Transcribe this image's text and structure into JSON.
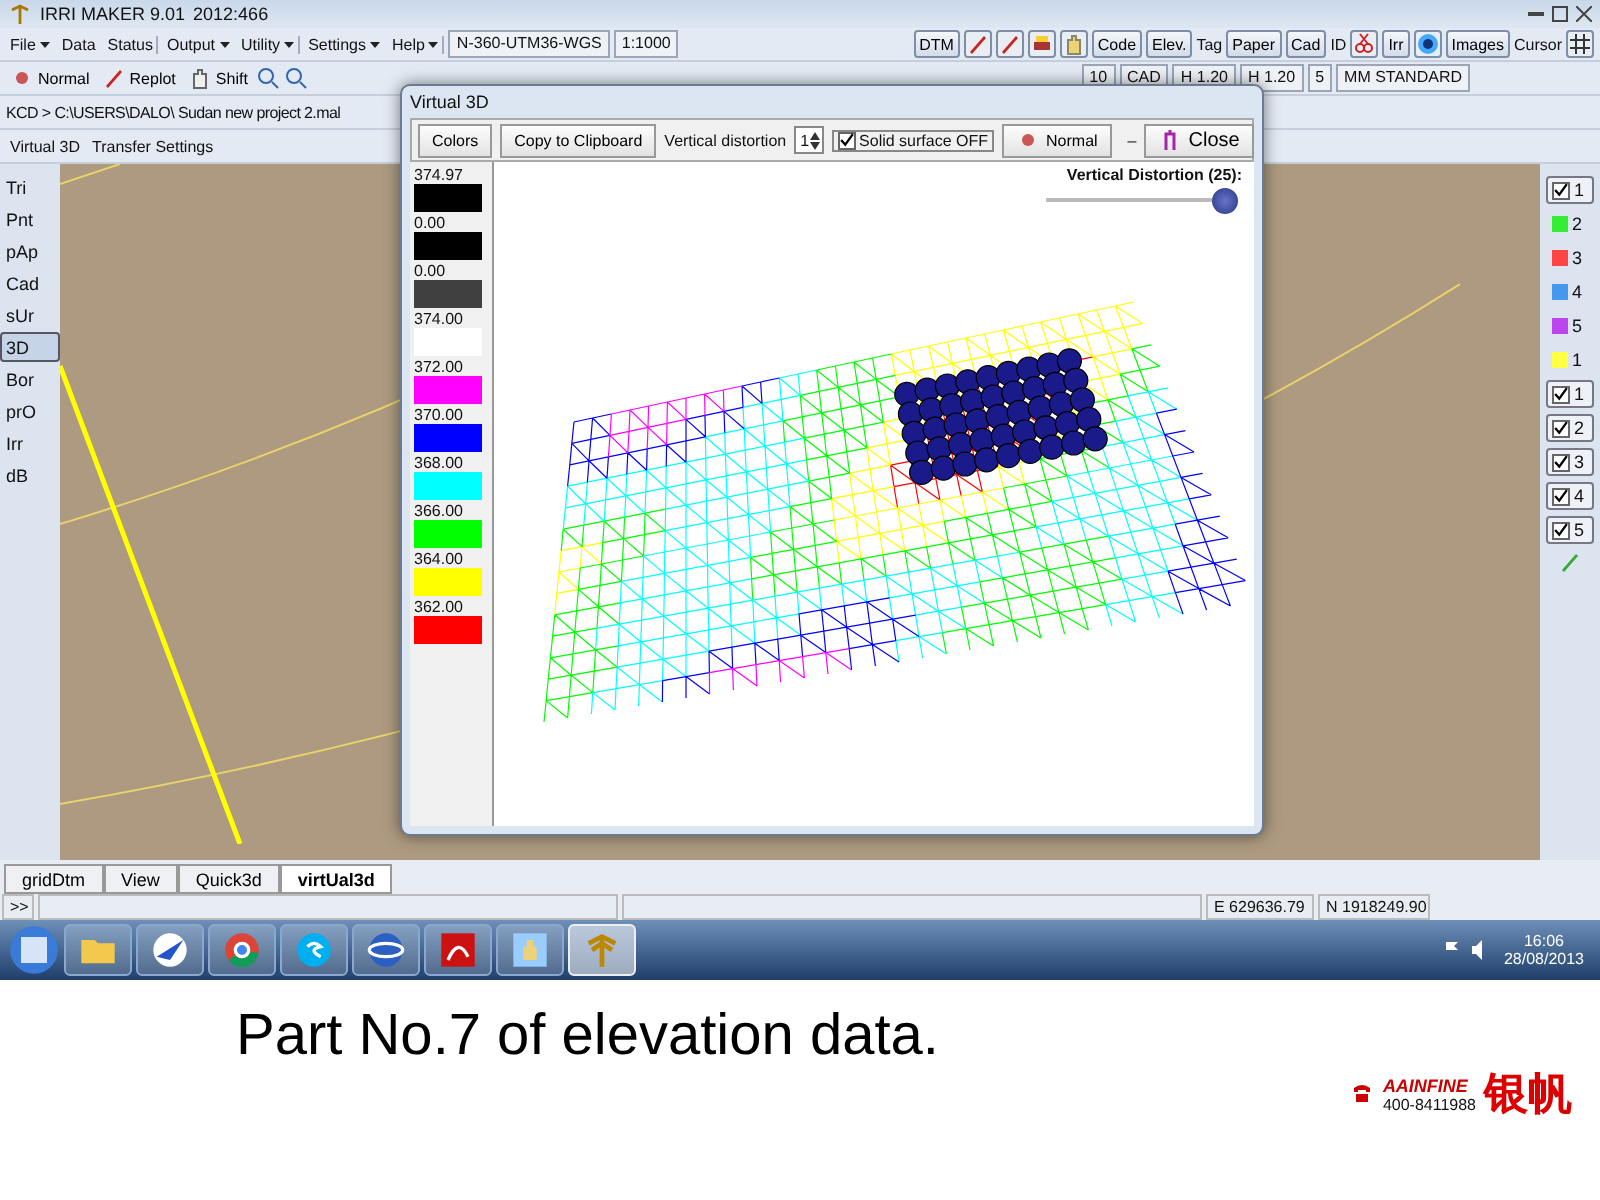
{
  "window": {
    "title": "IRRI MAKER  9.01",
    "build": "2012:466"
  },
  "menu": [
    {
      "label": "File",
      "dropdown": true,
      "group_end": false
    },
    {
      "label": "Data",
      "dropdown": false,
      "group_end": false
    },
    {
      "label": "Status",
      "dropdown": false,
      "group_end": true
    },
    {
      "label": "Output",
      "dropdown": true,
      "group_end": false
    },
    {
      "label": "Utility",
      "dropdown": true,
      "group_end": true
    },
    {
      "label": "Settings",
      "dropdown": true,
      "group_end": false
    },
    {
      "label": "Help",
      "dropdown": true,
      "group_end": true
    }
  ],
  "projection": "N-360-UTM36-WGS",
  "scale": "1:1000",
  "top_tools": [
    {
      "kind": "button",
      "label": "DTM"
    },
    {
      "kind": "icon"
    },
    {
      "kind": "icon"
    },
    {
      "kind": "icon"
    },
    {
      "kind": "icon"
    },
    {
      "kind": "button",
      "label": "Code"
    },
    {
      "kind": "button",
      "label": "Elev."
    },
    {
      "kind": "text",
      "label": "Tag"
    },
    {
      "kind": "button",
      "label": "Paper"
    },
    {
      "kind": "button",
      "label": "Cad"
    },
    {
      "kind": "text",
      "label": "ID"
    },
    {
      "kind": "icon"
    },
    {
      "kind": "button",
      "label": "Irr"
    },
    {
      "kind": "icon"
    },
    {
      "kind": "button",
      "label": "Images"
    },
    {
      "kind": "text",
      "label": "Cursor"
    },
    {
      "kind": "icon"
    }
  ],
  "view_tools": [
    "Normal",
    "Replot",
    "Shift"
  ],
  "style_tools": [
    "10",
    "CAD",
    "H 1.20",
    "H 1.20",
    "5",
    "MM STANDARD"
  ],
  "path": "KCD > C:\\USERS\\DALO\\ Sudan new project 2.mal",
  "panel_tabs": [
    "Virtual 3D",
    "Transfer Settings"
  ],
  "side_tools": [
    {
      "label": "Tri",
      "selected": false
    },
    {
      "label": "Pnt",
      "selected": false
    },
    {
      "label": "pAp",
      "selected": false
    },
    {
      "label": "Cad",
      "selected": false
    },
    {
      "label": "sUr",
      "selected": false
    },
    {
      "label": "3D",
      "selected": true
    },
    {
      "label": "Bor",
      "selected": false
    },
    {
      "label": "prO",
      "selected": false
    },
    {
      "label": "Irr",
      "selected": false
    },
    {
      "label": "dB",
      "selected": false
    }
  ],
  "layers": [
    {
      "kind": "check",
      "label": "1",
      "checked": true
    },
    {
      "kind": "swatch",
      "label": "2",
      "color": "#33ee33"
    },
    {
      "kind": "swatch",
      "label": "3",
      "color": "#ff4444"
    },
    {
      "kind": "swatch",
      "label": "4",
      "color": "#4499ee"
    },
    {
      "kind": "swatch",
      "label": "5",
      "color": "#bb44ee"
    },
    {
      "kind": "swatch",
      "label": "1",
      "color": "#ffff44"
    },
    {
      "kind": "check",
      "label": "1",
      "checked": true
    },
    {
      "kind": "check",
      "label": "2",
      "checked": true
    },
    {
      "kind": "check",
      "label": "3",
      "checked": true
    },
    {
      "kind": "check",
      "label": "4",
      "checked": true
    },
    {
      "kind": "check",
      "label": "5",
      "checked": true
    }
  ],
  "dialog": {
    "title": "Virtual 3D",
    "buttons": [
      "Colors",
      "Copy to Clipboard"
    ],
    "distortion_label": "Vertical distortion",
    "distortion_value": "1",
    "solid_surface": {
      "label": "Solid surface OFF",
      "checked": true
    },
    "normal_button": "Normal",
    "minimize": "–",
    "close_button": "Close",
    "slider_label": "Vertical Distortion (25):",
    "slider": {
      "level": 1.0
    },
    "legend": [
      {
        "value": "374.97",
        "color": "#000000"
      },
      {
        "value": "0.00",
        "color": "#000000"
      },
      {
        "value": "0.00",
        "color": "#404040"
      },
      {
        "value": "374.00",
        "color": "#ffffff"
      },
      {
        "value": "372.00",
        "color": "#ff00ff"
      },
      {
        "value": "370.00",
        "color": "#0000ff"
      },
      {
        "value": "368.00",
        "color": "#00ffff"
      },
      {
        "value": "366.00",
        "color": "#00ff00"
      },
      {
        "value": "364.00",
        "color": "#ffff00"
      },
      {
        "value": "362.00",
        "color": "#ff0000"
      }
    ]
  },
  "bottom_tabs": [
    {
      "label": "gridDtm",
      "selected": false
    },
    {
      "label": "View",
      "selected": false
    },
    {
      "label": "Quick3d",
      "selected": false
    },
    {
      "label": "virtUal3d",
      "selected": true
    }
  ],
  "status_bar": {
    "prompt": ">>",
    "easting": "E 629636.79",
    "northing": "N 1918249.90"
  },
  "taskbar": {
    "apps": [
      {
        "selected": false
      },
      {
        "selected": false
      },
      {
        "selected": false
      },
      {
        "selected": false
      },
      {
        "selected": false
      },
      {
        "selected": false
      },
      {
        "selected": false
      },
      {
        "selected": true
      }
    ],
    "time": "16:06",
    "date": "28/08/2013"
  },
  "caption": "Part No.7 of elevation data.",
  "logo": {
    "brand": "AAINFINE",
    "phone": "400-8411988",
    "name": "银帆"
  }
}
